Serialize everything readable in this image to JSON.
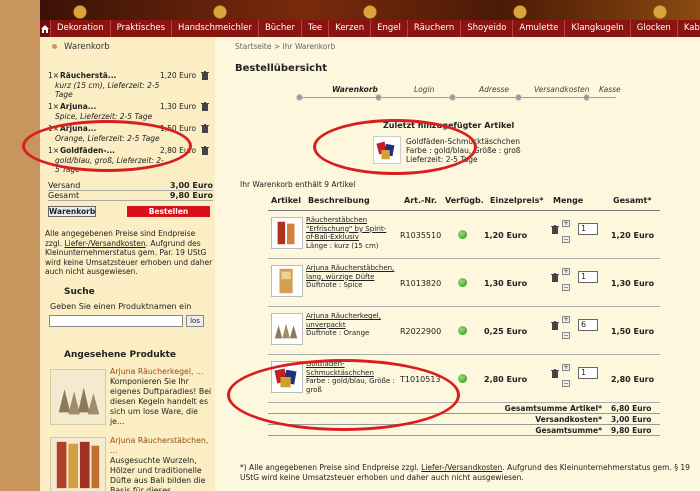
{
  "nav": {
    "items": [
      "Dekoration",
      "Praktisches",
      "Handschmeichler",
      "Bücher",
      "Tee",
      "Kerzen",
      "Engel",
      "Räuchern",
      "Shoyeido",
      "Amulette",
      "Klangkugeln",
      "Glocken",
      "Kabbala"
    ]
  },
  "sidebar": {
    "cart_title": "Warenkorb",
    "cart_items": [
      {
        "qty": "1×",
        "name": "Räucherstä...",
        "price": "1,20 Euro",
        "detail": "kurz (15 cm), Lieferzeit: 2-5 Tage"
      },
      {
        "qty": "1×",
        "name": "Arjuna...",
        "price": "1,30 Euro",
        "detail": "Spice, Lieferzeit: 2-5 Tage"
      },
      {
        "qty": "1×",
        "name": "Arjuna...",
        "price": "1,50 Euro",
        "detail": "Orange, Lieferzeit: 2-5 Tage"
      },
      {
        "qty": "1×",
        "name": "Goldfäden-...",
        "price": "2,80 Euro",
        "detail": "gold/blau, groß, Lieferzeit: 2-5 Tage"
      }
    ],
    "shipping_label": "Versand",
    "shipping_value": "3,00 Euro",
    "total_label": "Gesamt",
    "total_value": "9,80 Euro",
    "cart_button": "Warenkorb",
    "order_button": "Bestellen",
    "note_pre": "Alle angegebenen Preise sind Endpreise zzgl.",
    "note_link": "Liefer-/Versandkosten",
    "note_post": ". Aufgrund des Kleinunternehmerstatus gem. Par. 19 UStG wird keine Umsatzsteuer erhoben und daher auch nicht ausgewiesen.",
    "search_title": "Suche",
    "search_label": "Geben Sie einen Produktnamen ein",
    "search_value": "",
    "search_button": "los",
    "popular_title": "Angesehene Produkte",
    "popular": [
      {
        "title": "Arjuna Räucherkegel, ...",
        "text": "Komponieren Sie Ihr eigenes Duftparadies! Bei diesen Kegeln handelt es sich um lose Ware, die je..."
      },
      {
        "title": "Arjuna Räucherstäbchen, ...",
        "text": "Ausgesuchte Wurzeln, Hölzer und traditionelle Düfte aus Bali bilden die Basis für dieses..."
      }
    ]
  },
  "main": {
    "breadcrumb": "Startseite  >  Ihr Warenkorb",
    "heading": "Bestellübersicht",
    "steps": [
      "Warenkorb",
      "Login",
      "Adresse",
      "Versandkosten",
      "Kasse"
    ],
    "added_title": "Zuletzt hinzugefügter Artikel",
    "added_lines": [
      "Goldfäden-Schmucktäschchen",
      "Farbe : gold/blau, Größe : groß",
      "Lieferzeit: 2-5 Tage"
    ],
    "count_text": "Ihr Warenkorb enthält 9 Artikel",
    "columns": [
      "Artikel",
      "Beschreibung",
      "Art.-Nr.",
      "Verfügb.",
      "Einzelpreis*",
      "Menge",
      "Gesamt*"
    ],
    "rows": [
      {
        "desc": [
          "Räucherstäbchen",
          "\"Erfrischung\" by Spirit-",
          "of-Bali-Exklusiv"
        ],
        "attr": "Länge : kurz (15 cm)",
        "art": "R1035510",
        "price": "1,20 Euro",
        "qty": "1",
        "total": "1,20 Euro"
      },
      {
        "desc": [
          "Arjuna Räucherstäbchen,",
          "lang, würzige Düfte"
        ],
        "attr": "Duftnote : Spice",
        "art": "R1013820",
        "price": "1,30 Euro",
        "qty": "1",
        "total": "1,30 Euro"
      },
      {
        "desc": [
          "Arjuna Räucherkegel,",
          "unverpackt"
        ],
        "attr": "Duftnote : Orange",
        "art": "R2022900",
        "price": "0,25 Euro",
        "qty": "6",
        "total": "1,50 Euro"
      },
      {
        "desc": [
          "Goldfäden-",
          "Schmucktäschchen"
        ],
        "attr": "Farbe : gold/blau, Größe : groß",
        "art": "T1010513",
        "price": "2,80 Euro",
        "qty": "1",
        "total": "2,80 Euro"
      }
    ],
    "sum_articles_label": "Gesamtsumme Artikel*",
    "sum_articles": "6,80 Euro",
    "shipping_label": "Versandkosten*",
    "shipping": "3,00 Euro",
    "grand_label": "Gesamtsumme*",
    "grand": "9,80 Euro",
    "footnote_pre": "*) Alle angegebenen Preise sind Endpreise zzgl.",
    "footnote_link": "Liefer-/Versandkosten",
    "footnote_post": ". Aufgrund des Kleinunternehmerstatus gem. § 19 UStG wird keine Umsatzsteuer erhoben und daher auch nicht ausgewiesen."
  }
}
